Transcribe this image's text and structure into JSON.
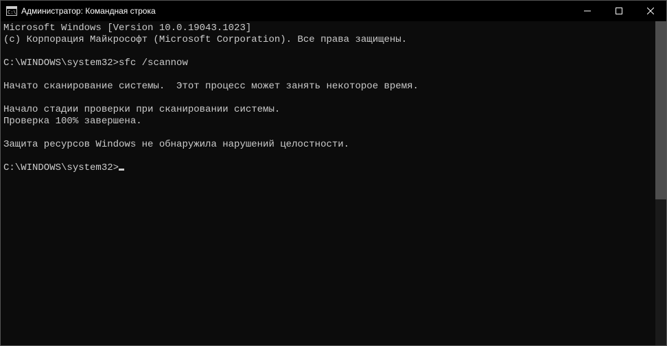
{
  "titlebar": {
    "title": "Администратор: Командная строка"
  },
  "console": {
    "line1": "Microsoft Windows [Version 10.0.19043.1023]",
    "line2": "(c) Корпорация Майкрософт (Microsoft Corporation). Все права защищены.",
    "blank1": "",
    "prompt1_path": "C:\\WINDOWS\\system32>",
    "prompt1_cmd": "sfc /scannow",
    "blank2": "",
    "line3": "Начато сканирование системы.  Этот процесс может занять некоторое время.",
    "blank3": "",
    "line4": "Начало стадии проверки при сканировании системы.",
    "line5": "Проверка 100% завершена.",
    "blank4": "",
    "line6": "Защита ресурсов Windows не обнаружила нарушений целостности.",
    "blank5": "",
    "prompt2_path": "C:\\WINDOWS\\system32>"
  }
}
